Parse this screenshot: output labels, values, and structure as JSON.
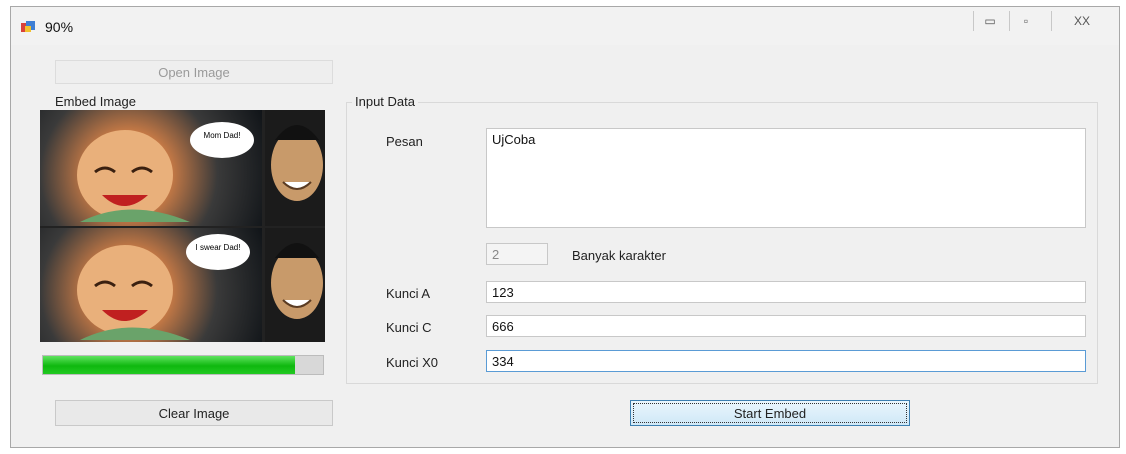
{
  "window": {
    "title": "90%",
    "min_glyph": "▭",
    "max_glyph": "▫",
    "close_glyph": "XX"
  },
  "left_panel": {
    "open_image_label": "Open Image",
    "group_label": "Embed Image",
    "progress_fraction": 0.9,
    "clear_image_label": "Clear Image"
  },
  "input_group": {
    "group_label": "Input Data",
    "pesan_label": "Pesan",
    "pesan_value": "UjCoba",
    "char_count_value": "2",
    "char_count_label": "Banyak karakter",
    "kunci_a_label": "Kunci A",
    "kunci_a_value": "123",
    "kunci_c_label": "Kunci C",
    "kunci_c_value": "666",
    "kunci_x0_label": "Kunci X0",
    "kunci_x0_value": "334"
  },
  "start_embed_label": "Start Embed",
  "meme_captions": {
    "top": "Mom Dad!",
    "bottom": "I swear Dad!"
  },
  "colors": {
    "progress_green": "#0fb80f",
    "button_focus": "#4a90d9"
  }
}
